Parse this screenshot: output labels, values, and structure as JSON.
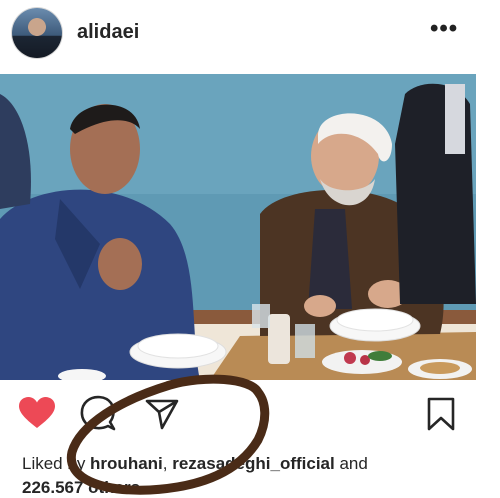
{
  "post": {
    "username": "alidaei",
    "more_glyph": "•••"
  },
  "likes": {
    "prefix": "Liked by ",
    "user1": "hrouhani",
    "separator": ", ",
    "user2": "rezasadeghi_official",
    "and": " and",
    "others": "226.567 others"
  },
  "icons": {
    "like": "heart-icon",
    "comment": "comment-icon",
    "share": "share-icon",
    "save": "bookmark-icon"
  },
  "colors": {
    "heart": "#ed4956",
    "scribble": "#4a2b17",
    "photo_wall": "#5f9ab4"
  }
}
